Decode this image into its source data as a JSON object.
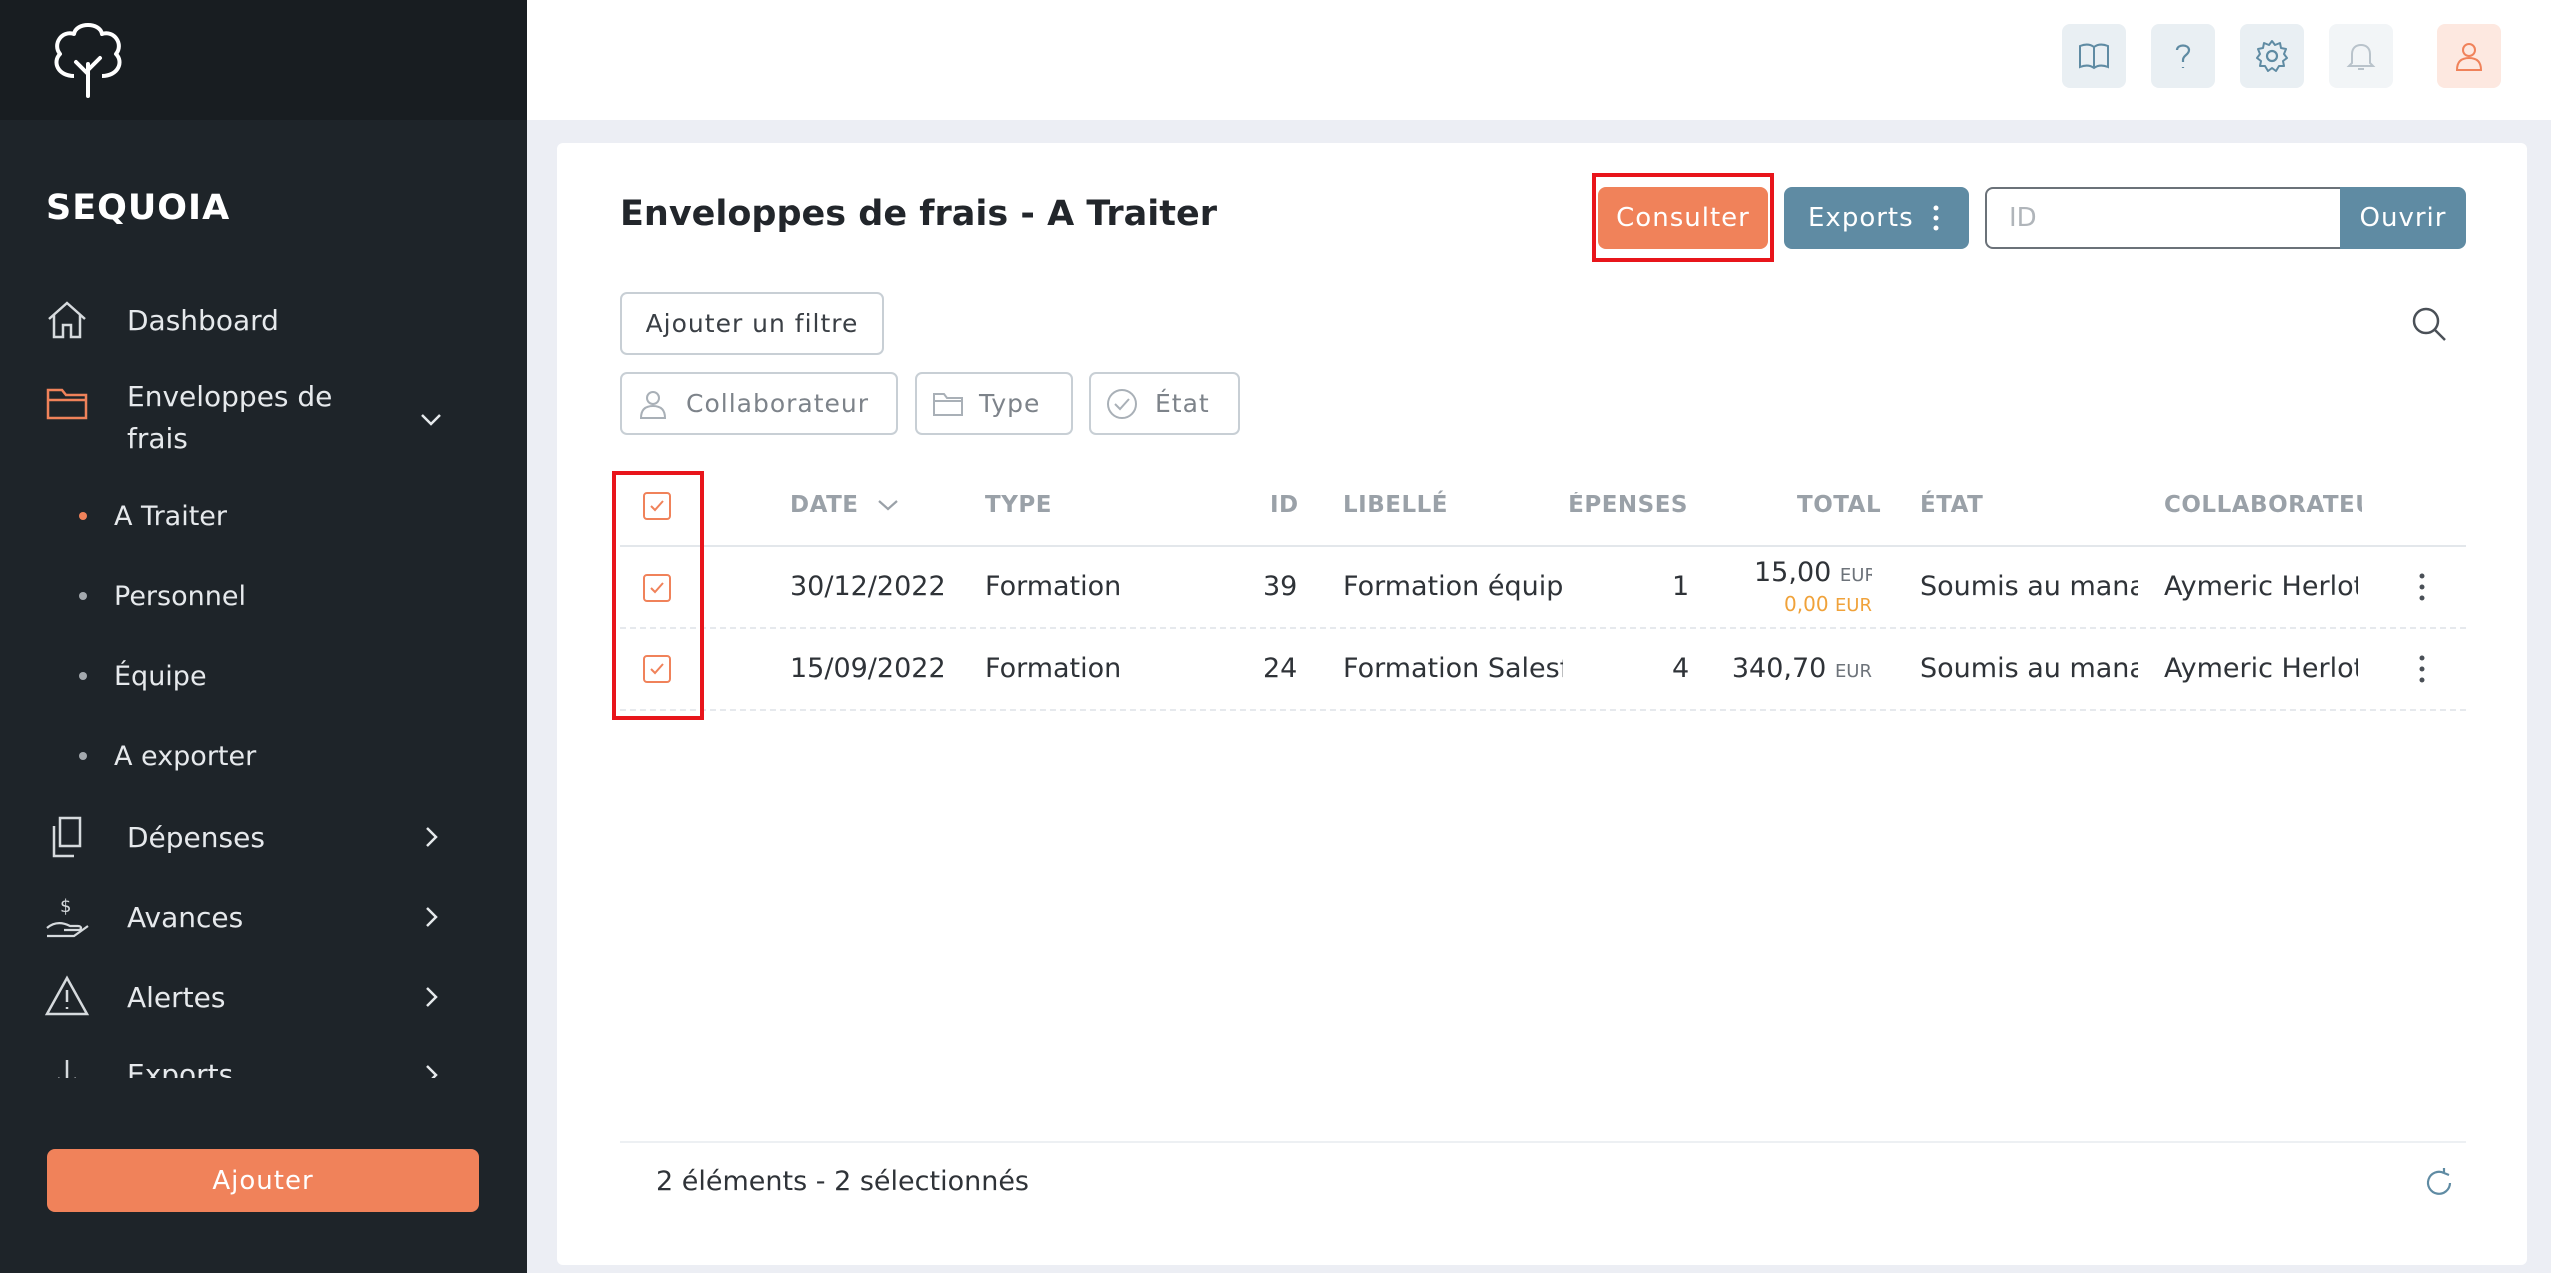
{
  "sidebar": {
    "brand": "SEQUOIA",
    "items": [
      {
        "label": "Dashboard",
        "icon": "home-icon"
      },
      {
        "label": "Enveloppes de",
        "label2": "frais",
        "icon": "folder-icon",
        "expanded": true
      },
      {
        "label": "Dépenses",
        "icon": "documents-icon"
      },
      {
        "label": "Avances",
        "icon": "money-hand-icon"
      },
      {
        "label": "Alertes",
        "icon": "warning-icon"
      },
      {
        "label": "Exports",
        "icon": "download-icon"
      }
    ],
    "sub_items": [
      {
        "label": "A Traiter",
        "active": true
      },
      {
        "label": "Personnel",
        "active": false
      },
      {
        "label": "Équipe",
        "active": false
      },
      {
        "label": "A exporter",
        "active": false
      }
    ],
    "add_button": "Ajouter"
  },
  "header": {
    "icons": [
      "book-icon",
      "help-icon",
      "gear-icon",
      "bell-icon",
      "user-icon"
    ]
  },
  "main": {
    "title": "Enveloppes de frais - A Traiter",
    "consult_button": "Consulter",
    "exports_button": "Exports",
    "id_placeholder": "ID",
    "open_button": "Ouvrir",
    "add_filter_button": "Ajouter un filtre",
    "chips": [
      "Collaborateur",
      "Type",
      "État"
    ],
    "columns": {
      "date": "DATE",
      "type": "TYPE",
      "id": "ID",
      "libelle": "LIBELLÉ",
      "depenses": "DÉPENSES",
      "total": "TOTAL",
      "etat": "ÉTAT",
      "collaborateur": "COLLABORATEUR"
    },
    "rows": [
      {
        "date": "30/12/2022",
        "type": "Formation",
        "id": "39",
        "libelle": "Formation équipe",
        "depenses": "1",
        "total": "15,00",
        "currency": "EUR",
        "sub_total": "0,00",
        "sub_currency": "EUR",
        "etat": "Soumis au manager",
        "collaborateur": "Aymeric Herlot",
        "checked": true
      },
      {
        "date": "15/09/2022",
        "type": "Formation",
        "id": "24",
        "libelle": "Formation Salesforce",
        "depenses": "4",
        "total": "340,70",
        "currency": "EUR",
        "etat": "Soumis au manager",
        "collaborateur": "Aymeric Herlot",
        "checked": true
      }
    ],
    "footer": {
      "count": "2 éléments",
      "separator": " - ",
      "selected": "2 sélectionnés"
    }
  },
  "colors": {
    "accent": "#f0825a",
    "secondary": "#5f8ba3",
    "sidebar_bg": "#1e2429",
    "highlight": "#e8151b"
  }
}
